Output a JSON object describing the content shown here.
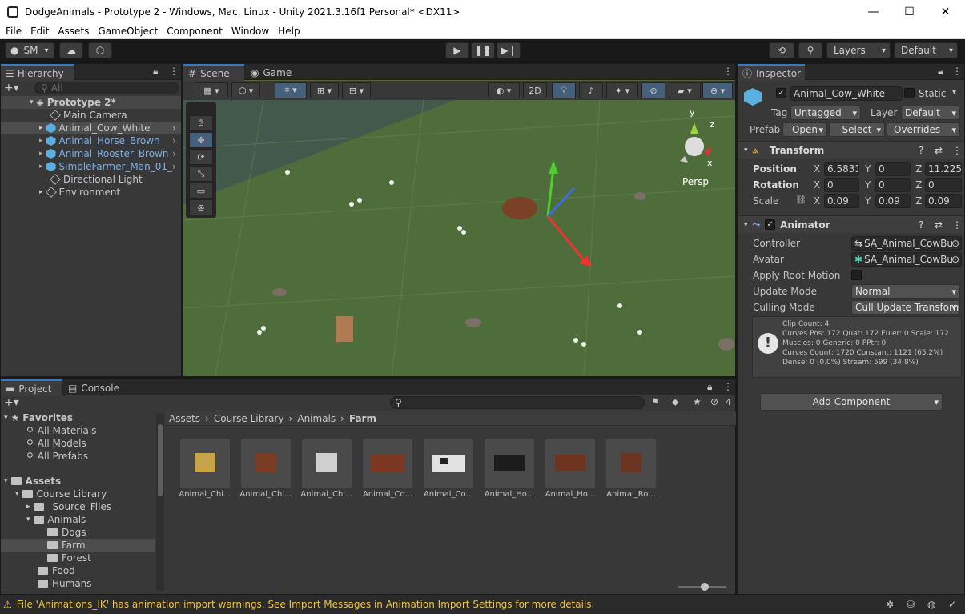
{
  "window": {
    "title": "DodgeAnimals - Prototype 2 - Windows, Mac, Linux - Unity 2021.3.16f1 Personal* <DX11>",
    "minimize": "—",
    "maximize": "☐",
    "close": "✕"
  },
  "menu": [
    "File",
    "Edit",
    "Assets",
    "GameObject",
    "Component",
    "Window",
    "Help"
  ],
  "toolbar": {
    "account": "SM",
    "layers": "Layers",
    "layout": "Default"
  },
  "hierarchy": {
    "tab": "Hierarchy",
    "search_placeholder": "All",
    "scene": "Prototype 2*",
    "items": [
      {
        "label": "Main Camera"
      },
      {
        "label": "Animal_Cow_White"
      },
      {
        "label": "Animal_Horse_Brown"
      },
      {
        "label": "Animal_Rooster_Brown"
      },
      {
        "label": "SimpleFarmer_Man_01_"
      },
      {
        "label": "Directional Light"
      },
      {
        "label": "Environment"
      }
    ]
  },
  "scene": {
    "tabs": [
      "Scene",
      "Game"
    ],
    "mode_2d": "2D",
    "persp": "Persp",
    "gizmo_y": "y",
    "gizmo_z": "z",
    "gizmo_x": "x"
  },
  "inspector": {
    "tab": "Inspector",
    "object_name": "Animal_Cow_White",
    "static": "Static",
    "tag_label": "Tag",
    "tag": "Untagged",
    "layer_label": "Layer",
    "layer": "Default",
    "prefab_label": "Prefab",
    "open": "Open",
    "select": "Select",
    "overrides": "Overrides",
    "transform": {
      "title": "Transform",
      "position": "Position",
      "rotation": "Rotation",
      "scale": "Scale",
      "pos": [
        "6.5831",
        "0",
        "11.225"
      ],
      "rot": [
        "0",
        "0",
        "0"
      ],
      "scl": [
        "0.09",
        "0.09",
        "0.09"
      ],
      "x": "X",
      "y": "Y",
      "z": "Z"
    },
    "animator": {
      "title": "Animator",
      "controller_label": "Controller",
      "controller": "SA_Animal_CowBu",
      "avatar_label": "Avatar",
      "avatar": "SA_Animal_CowBu",
      "root_motion": "Apply Root Motion",
      "update_label": "Update Mode",
      "update": "Normal",
      "culling_label": "Culling Mode",
      "culling": "Cull Update Transform",
      "info": [
        "Clip Count: 4",
        "Curves Pos: 172 Quat: 172 Euler: 0 Scale: 172",
        "Muscles: 0 Generic: 0 PPtr: 0",
        "Curves Count: 1720 Constant: 1121 (65.2%)",
        "Dense: 0 (0.0%) Stream: 599 (34.8%)"
      ]
    },
    "add_component": "Add Component"
  },
  "project": {
    "tabs": [
      "Project",
      "Console"
    ],
    "hidden_count": "4",
    "favorites": "Favorites",
    "fav_items": [
      "All Materials",
      "All Models",
      "All Prefabs"
    ],
    "assets": "Assets",
    "tree": [
      "Course Library",
      "_Source_Files",
      "Animals",
      "Dogs",
      "Farm",
      "Forest",
      "Food",
      "Humans"
    ],
    "breadcrumb": [
      "Assets",
      "Course Library",
      "Animals",
      "Farm"
    ],
    "files": [
      "Animal_Chi...",
      "Animal_Chi...",
      "Animal_Chi...",
      "Animal_Co...",
      "Animal_Co...",
      "Animal_Ho...",
      "Animal_Ho...",
      "Animal_Ro..."
    ]
  },
  "status": {
    "message": "File 'Animations_IK' has animation import warnings. See Import Messages in Animation Import Settings for more details."
  }
}
